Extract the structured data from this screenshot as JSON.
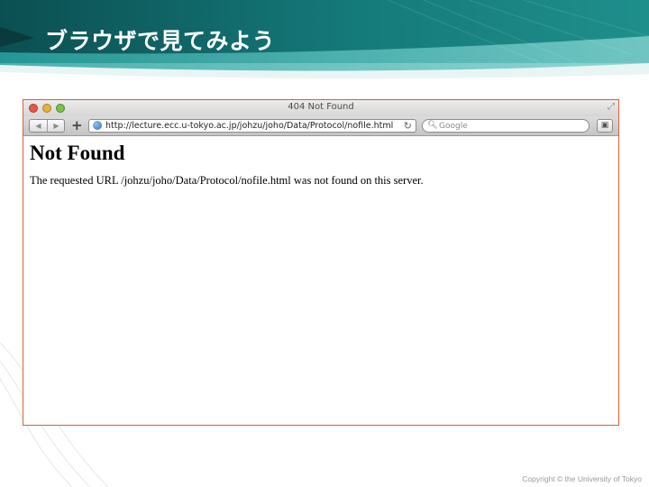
{
  "slide": {
    "title": "ブラウザで見てみよう",
    "copyright": "Copyright © the University of Tokyo"
  },
  "browser": {
    "window_title": "404 Not Found",
    "url": "http://lecture.ecc.u-tokyo.ac.jp/johzu/joho/Data/Protocol/nofile.html",
    "search_placeholder": "Google",
    "page": {
      "heading": "Not Found",
      "message": "The requested URL /johzu/joho/Data/Protocol/nofile.html was not found on this server."
    }
  },
  "colors": {
    "banner_dark": "#0e5f5e",
    "banner_teal": "#1d8c8a",
    "window_border": "#d9603b"
  }
}
